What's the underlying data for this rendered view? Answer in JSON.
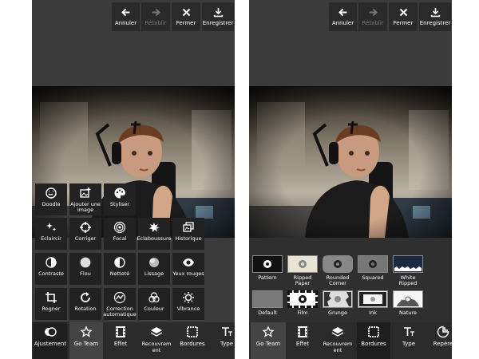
{
  "toolbar": {
    "undo": "Annuler",
    "redo": "Rétablir",
    "close": "Fermer",
    "save": "Enregistrer"
  },
  "tools": [
    {
      "name": "doodle",
      "label": "Doodle",
      "icon": "doodle-icon"
    },
    {
      "name": "add-image",
      "label": "Ajouter une image",
      "icon": "add-image-icon"
    },
    {
      "name": "stylize",
      "label": "Styliser",
      "icon": "palette-icon"
    },
    {
      "name": "brighten",
      "label": "Eclaircir",
      "icon": "sparkle-icon"
    },
    {
      "name": "correct",
      "label": "Corriger",
      "icon": "target-icon"
    },
    {
      "name": "focal",
      "label": "Focal",
      "icon": "focal-icon"
    },
    {
      "name": "splash",
      "label": "Eclaboussure",
      "icon": "splash-icon"
    },
    {
      "name": "history",
      "label": "Historique",
      "icon": "history-icon"
    },
    {
      "name": "contrast",
      "label": "Contraste",
      "icon": "contrast-icon"
    },
    {
      "name": "blur",
      "label": "Flou",
      "icon": "blur-icon"
    },
    {
      "name": "sharpness",
      "label": "Netteté",
      "icon": "sharpness-icon"
    },
    {
      "name": "smoothing",
      "label": "Lissage",
      "icon": "smoothing-icon"
    },
    {
      "name": "red-eye",
      "label": "Yeux rouges",
      "icon": "eye-icon"
    },
    {
      "name": "crop",
      "label": "Rogner",
      "icon": "crop-icon"
    },
    {
      "name": "rotation",
      "label": "Rotation",
      "icon": "rotate-icon"
    },
    {
      "name": "auto-correct",
      "label": "Correction automatique",
      "icon": "auto-correct-icon"
    },
    {
      "name": "color",
      "label": "Couleur",
      "icon": "color-icon"
    },
    {
      "name": "vibrance",
      "label": "Vibrance",
      "icon": "vibrance-icon"
    }
  ],
  "bottom_left": [
    {
      "label": "Ajustement",
      "icon": "adjust-icon"
    },
    {
      "label": "Go Team",
      "icon": "star-icon"
    },
    {
      "label": "Effet",
      "icon": "film-icon"
    },
    {
      "label": "Recouvrement",
      "icon": "layers-icon"
    },
    {
      "label": "Bordures",
      "icon": "borders-icon"
    },
    {
      "label": "Type",
      "icon": "text-icon"
    }
  ],
  "bottom_right": [
    {
      "label": "Go Team",
      "icon": "star-icon"
    },
    {
      "label": "Effet",
      "icon": "film-icon"
    },
    {
      "label": "Recouvrement",
      "icon": "layers-icon"
    },
    {
      "label": "Bordures",
      "icon": "borders-icon"
    },
    {
      "label": "Type",
      "icon": "text-icon"
    },
    {
      "label": "Repère",
      "icon": "sticker-icon"
    }
  ],
  "borders": [
    {
      "label": "Pattern"
    },
    {
      "label": "Ripped Paper"
    },
    {
      "label": "Rounded Corner"
    },
    {
      "label": "Squared"
    },
    {
      "label": "White Ripped"
    },
    {
      "label": "Default"
    },
    {
      "label": "Film"
    },
    {
      "label": "Grunge"
    },
    {
      "label": "Ink"
    },
    {
      "label": "Nature"
    }
  ]
}
